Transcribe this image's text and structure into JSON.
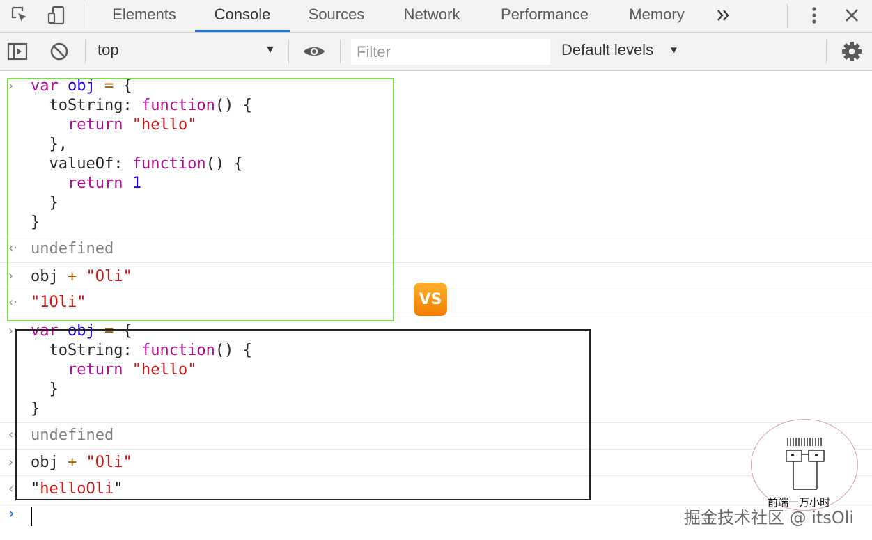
{
  "tabs": [
    {
      "label": "Elements"
    },
    {
      "label": "Console"
    },
    {
      "label": "Sources"
    },
    {
      "label": "Network"
    },
    {
      "label": "Performance"
    },
    {
      "label": "Memory"
    }
  ],
  "toolbar": {
    "context": "top",
    "filter_placeholder": "Filter",
    "levels": "Default levels"
  },
  "entry1": {
    "input_lines": [
      {
        "parts": [
          {
            "t": "var",
            "c": "kw"
          },
          {
            "t": " "
          },
          {
            "t": "obj",
            "c": "var"
          },
          {
            "t": " "
          },
          {
            "t": "=",
            "c": "op"
          },
          {
            "t": " {"
          }
        ]
      },
      {
        "parts": [
          {
            "t": "  toString: "
          },
          {
            "t": "function",
            "c": "kw"
          },
          {
            "t": "() {"
          }
        ]
      },
      {
        "parts": [
          {
            "t": "    "
          },
          {
            "t": "return",
            "c": "kw"
          },
          {
            "t": " "
          },
          {
            "t": "\"hello\"",
            "c": "str"
          }
        ]
      },
      {
        "parts": [
          {
            "t": "  },"
          }
        ]
      },
      {
        "parts": [
          {
            "t": "  valueOf: "
          },
          {
            "t": "function",
            "c": "kw"
          },
          {
            "t": "() {"
          }
        ]
      },
      {
        "parts": [
          {
            "t": "    "
          },
          {
            "t": "return",
            "c": "kw"
          },
          {
            "t": " "
          },
          {
            "t": "1",
            "c": "num"
          }
        ]
      },
      {
        "parts": [
          {
            "t": "  }"
          }
        ]
      },
      {
        "parts": [
          {
            "t": "}"
          }
        ]
      }
    ],
    "result": "undefined",
    "expr_obj": "obj",
    "expr_op": "+",
    "expr_str": "\"Oli\"",
    "output": "\"1Oli\""
  },
  "vs_badge": "VS",
  "entry2": {
    "input_lines": [
      {
        "parts": [
          {
            "t": "var",
            "c": "kw"
          },
          {
            "t": " "
          },
          {
            "t": "obj",
            "c": "var"
          },
          {
            "t": " "
          },
          {
            "t": "=",
            "c": "op"
          },
          {
            "t": " {"
          }
        ]
      },
      {
        "parts": [
          {
            "t": "  toString: "
          },
          {
            "t": "function",
            "c": "kw"
          },
          {
            "t": "() {"
          }
        ]
      },
      {
        "parts": [
          {
            "t": "    "
          },
          {
            "t": "return",
            "c": "kw"
          },
          {
            "t": " "
          },
          {
            "t": "\"hello\"",
            "c": "str"
          }
        ]
      },
      {
        "parts": [
          {
            "t": "  }"
          }
        ]
      },
      {
        "parts": [
          {
            "t": "}"
          }
        ]
      }
    ],
    "result": "undefined",
    "expr_obj": "obj",
    "expr_op": "+",
    "expr_str": "\"Oli\"",
    "output_q1": "\"",
    "output_val": "helloOli",
    "output_q2": "\""
  },
  "watermark": {
    "stamp_text": "前端一万小时",
    "community": "掘金技术社区 @ itsOli"
  },
  "colors": {
    "keyword": "#aa0d91",
    "variable": "#1c00cf",
    "string": "#c41a16",
    "number": "#1c00cf",
    "active_tab": "#1a73e8",
    "box_green": "#7ed957"
  }
}
